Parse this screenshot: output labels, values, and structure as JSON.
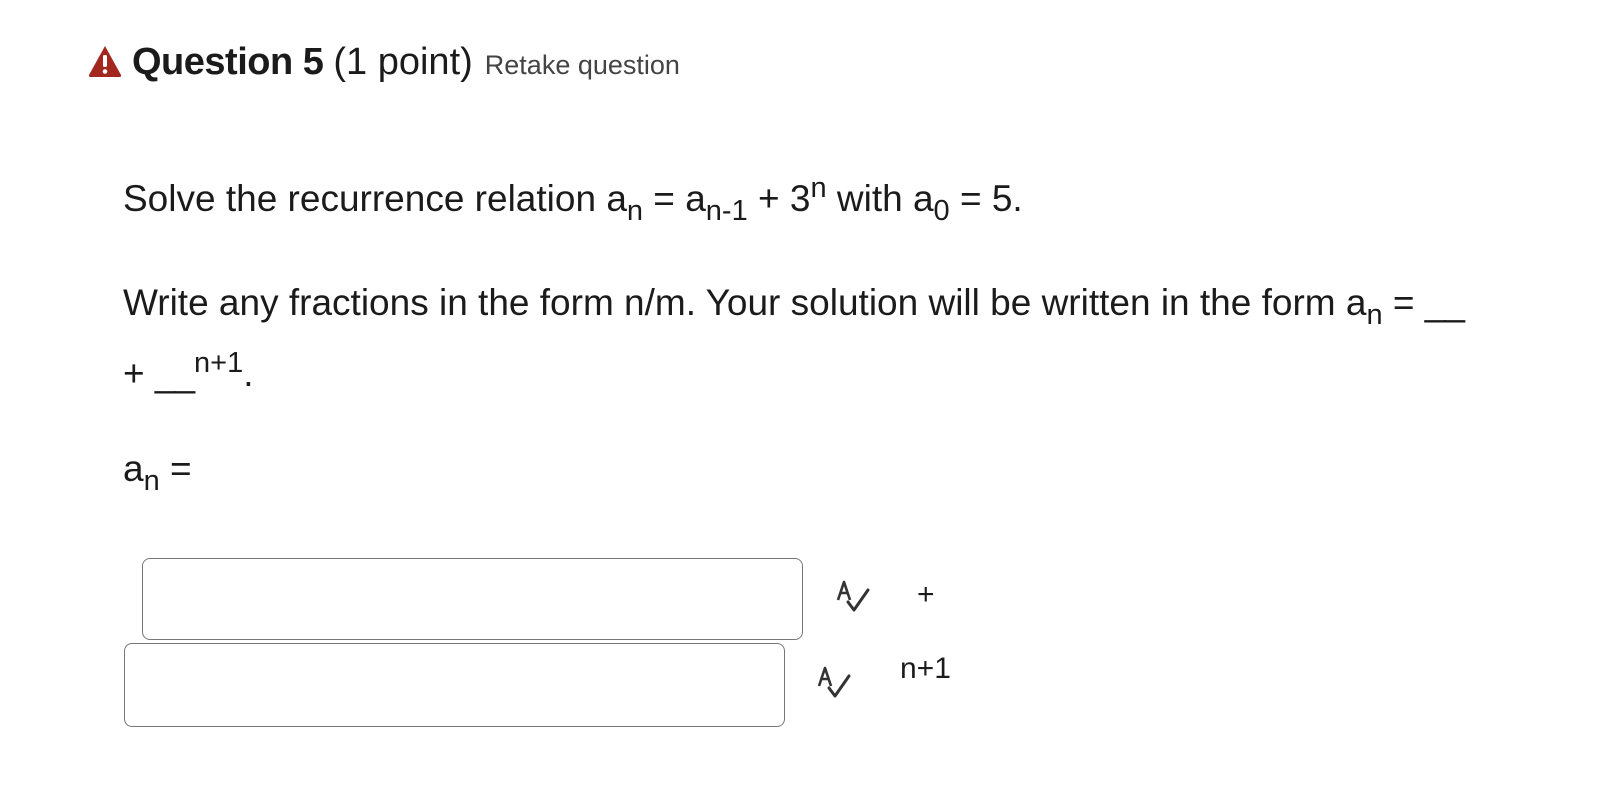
{
  "header": {
    "title": "Question 5",
    "points": "(1 point)",
    "retake_label": "Retake question",
    "warning_color": "#a3271f"
  },
  "problem": {
    "line1_text": "Solve the recurrence relation a",
    "line1_sub_n": "n",
    "line1_eq": " = a",
    "line1_sub_n1": "n-1",
    "line1_plus": " + 3",
    "line1_sup_n": "n",
    "line1_with": " with a",
    "line1_sub_0": "0",
    "line1_end": " = 5.",
    "line2_text": "Write any fractions in the form n/m. Your solution will be written in the form a",
    "line2_sub_n": "n",
    "line2_eq": " = ",
    "line2_blank": "__",
    "line3_plus": "+ ",
    "line3_blank": "__",
    "line3_sup": "n+1",
    "line3_end": ".",
    "answer_label_a": "a",
    "answer_label_sub": "n",
    "answer_label_eq": " ="
  },
  "inputs": [
    {
      "value": "",
      "after_text": "+"
    },
    {
      "value": "",
      "after_text": "n+1"
    }
  ],
  "icons": {
    "warning": "warning-triangle-icon",
    "spellcheck": "spellcheck-icon"
  }
}
